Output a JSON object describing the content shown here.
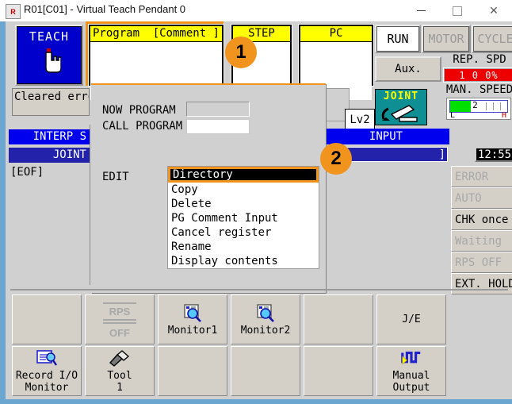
{
  "window": {
    "title": "R01[C01] - Virtual Teach Pendant 0",
    "icon": "app-icon",
    "minimize": "minimize-icon",
    "maximize": "maximize-icon",
    "close": "✕"
  },
  "top": {
    "teach": {
      "label": "TEACH",
      "icon": "hand-pointer-icon"
    },
    "program_panel": {
      "header_left": "Program",
      "header_right": "[Comment ]",
      "value_open": "[",
      "value_close": "]"
    },
    "step_panel": {
      "header": "STEP",
      "value_open": "[",
      "value_close": "]"
    },
    "pc_panel": {
      "header": "PC",
      "value_open": "",
      "value_close": ""
    },
    "run": "RUN",
    "motor": "MOTOR",
    "cycle": "CYCLE",
    "aux": "Aux.",
    "rep_spd_label": "REP. SPD",
    "rep_spd_value": "1 0 0%",
    "man_speed_label": "MAN. SPEED",
    "man_speed_value": "2",
    "man_speed_low": "L",
    "man_speed_high": "H"
  },
  "left": {
    "error_text": "Cleared erro",
    "interp": "INTERP S",
    "joint": "JOINT",
    "eof": "[EOF]"
  },
  "popup": {
    "now_program_label": "NOW PROGRAM",
    "call_program_label": "CALL PROGRAM",
    "now_program_value": "",
    "call_program_value": "",
    "edit_label": "EDIT",
    "menu": [
      "Directory",
      "Copy",
      "Delete",
      "PG Comment Input",
      "Cancel register",
      "Rename",
      "Display contents"
    ]
  },
  "right": {
    "level": "Lv2",
    "joint_icon_label": "JOINT",
    "input_bar": "INPUT",
    "input_open": "[",
    "input_close": "]",
    "clock": "12:55",
    "status": [
      {
        "label": "ERROR",
        "dim": true
      },
      {
        "label": "AUTO",
        "dim": true
      },
      {
        "label": "CHK once",
        "dim": false
      },
      {
        "label": "Waiting",
        "dim": true
      },
      {
        "label": "RPS OFF",
        "dim": true
      },
      {
        "label": "EXT. HOLD",
        "dim": false
      }
    ]
  },
  "function_keys": [
    {
      "top_label": "",
      "top_icon": "",
      "bottom_label": "Record I/O\nMonitor",
      "bottom_icon": "record-io-monitor-icon"
    },
    {
      "top_label": "RPS\nOFF",
      "top_icon": "rps-icon",
      "bottom_label": "Tool\n1",
      "bottom_icon": "tool-icon"
    },
    {
      "top_label": "Monitor1",
      "top_icon": "monitor-search-icon",
      "bottom_label": "",
      "bottom_icon": ""
    },
    {
      "top_label": "Monitor2",
      "top_icon": "monitor-search-icon",
      "bottom_label": "",
      "bottom_icon": ""
    },
    {
      "top_label": "",
      "top_icon": "",
      "bottom_label": "",
      "bottom_icon": ""
    },
    {
      "top_label": "J/E",
      "top_icon": "",
      "bottom_label": "Manual\nOutput",
      "bottom_icon": "manual-output-icon"
    }
  ],
  "badges": {
    "one": "1",
    "two": "2"
  },
  "colors": {
    "accent_orange": "#f0941e",
    "teach_blue": "#0000cc",
    "header_yellow": "#ffff00",
    "status_blue": "#0000ee",
    "joint_navy": "#2222aa",
    "speed_red": "#ee0000",
    "gauge_green": "#00e000",
    "joint_teal": "#0d8f93",
    "frame_blue": "#6aa6cf"
  }
}
